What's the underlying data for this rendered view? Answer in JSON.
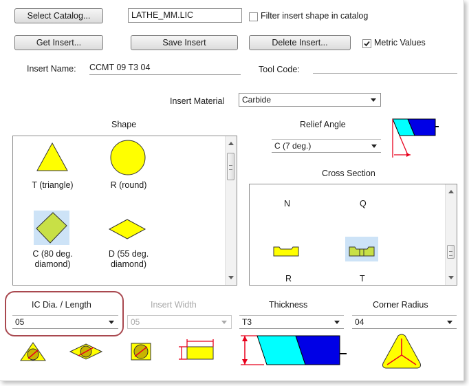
{
  "catalog": {
    "select_button": "Select Catalog...",
    "file_value": "LATHE_MM.LIC",
    "filter_label": "Filter insert shape in catalog",
    "filter_checked": false
  },
  "actions": {
    "get_insert": "Get Insert...",
    "save_insert": "Save Insert",
    "delete_insert": "Delete Insert...",
    "metric_label": "Metric Values",
    "metric_checked": true
  },
  "insert": {
    "name_label": "Insert Name:",
    "name_value": "CCMT 09 T3 04",
    "tool_code_label": "Tool Code:",
    "tool_code_value": ""
  },
  "material": {
    "label": "Insert Material",
    "value": "Carbide"
  },
  "shape": {
    "title": "Shape",
    "items": [
      {
        "label": "T (triangle)",
        "icon": "triangle-shape-icon",
        "selected": false
      },
      {
        "label": "R (round)",
        "icon": "round-shape-icon",
        "selected": false
      },
      {
        "label": "C (80 deg. diamond)",
        "icon": "diamond-80-shape-icon",
        "selected": true
      },
      {
        "label": "D (55 deg. diamond)",
        "icon": "diamond-55-shape-icon",
        "selected": false
      }
    ]
  },
  "relief": {
    "title": "Relief Angle",
    "value": "C (7 deg.)"
  },
  "cross_section": {
    "title": "Cross Section",
    "items": [
      {
        "label": "N",
        "selected": false
      },
      {
        "label": "Q",
        "selected": false
      },
      {
        "label": "R",
        "selected": false
      },
      {
        "label": "T",
        "selected": true
      }
    ]
  },
  "dimensions": {
    "ic_label": "IC Dia. / Length",
    "ic_value": "05",
    "width_label": "Insert Width",
    "width_value": "05",
    "thickness_label": "Thickness",
    "thickness_value": "T3",
    "corner_label": "Corner Radius",
    "corner_value": "04"
  },
  "colors": {
    "shape_fill": "#ffff00",
    "selection": "#cde3f7",
    "highlight_outline": "#a9484f",
    "dimension_red": "#e8001c",
    "cyan": "#00ffff",
    "blue": "#0000e6"
  }
}
